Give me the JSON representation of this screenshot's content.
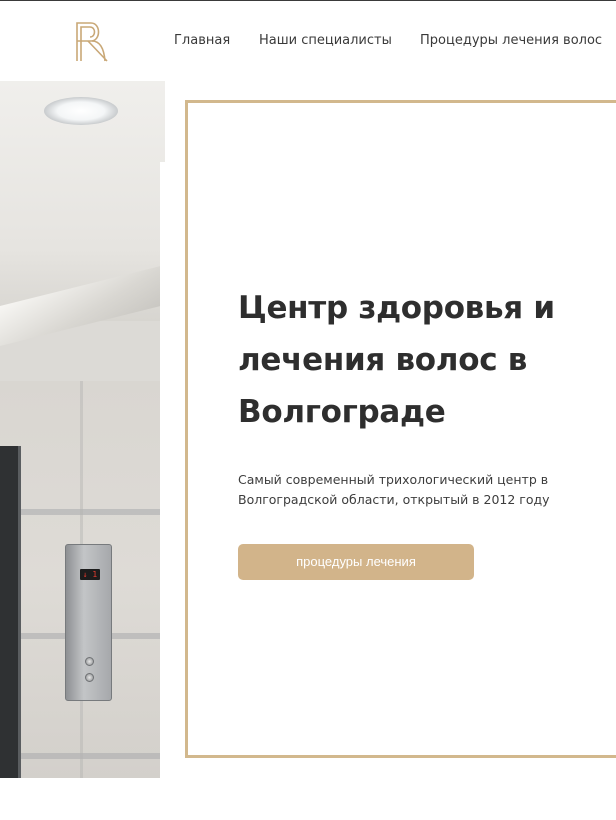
{
  "nav": {
    "items": [
      {
        "label": "Главная"
      },
      {
        "label": "Наши специалисты"
      },
      {
        "label": "Процедуры лечения волос"
      }
    ]
  },
  "hero": {
    "title": "Центр здоровья и лечения волос в Волгограде",
    "subtitle": "Самый современный трихологический центр в Волгоградской области, открытый в 2012 году",
    "cta_label": "процедуры лечения"
  },
  "photo": {
    "elevator_display": "↓ 1"
  },
  "colors": {
    "accent": "#d2b48a",
    "text": "#2e2e2e"
  },
  "icons": {
    "logo": "rr-monogram-logo"
  }
}
